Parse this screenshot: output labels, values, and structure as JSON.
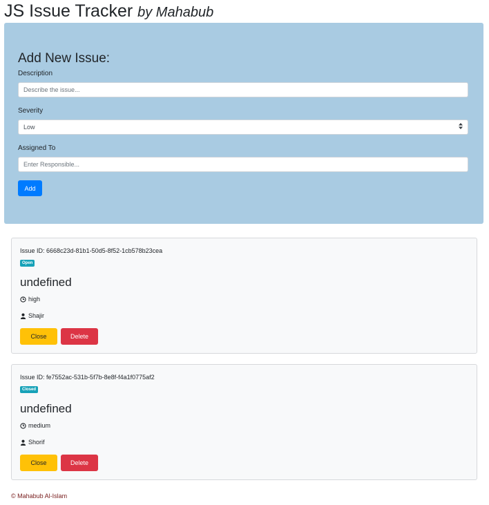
{
  "header": {
    "title": "JS Issue Tracker",
    "byline": "by Mahabub"
  },
  "form": {
    "heading": "Add New Issue:",
    "description_label": "Description",
    "description_placeholder": "Describe the issue...",
    "severity_label": "Severity",
    "severity_value": "Low",
    "assigned_label": "Assigned To",
    "assigned_placeholder": "Enter Responsible...",
    "add_label": "Add"
  },
  "issues": [
    {
      "id_text": "Issue ID: 6668c23d-81b1-50d5-8f52-1cb578b23cea",
      "status": "Open",
      "title": "undefined",
      "severity": "high",
      "assignee": "Shajir",
      "close_label": "Close",
      "delete_label": "Delete"
    },
    {
      "id_text": "Issue ID: fe7552ac-531b-5f7b-8e8f-f4a1f0775af2",
      "status": "Closed",
      "title": "undefined",
      "severity": "medium",
      "assignee": "Shorif",
      "close_label": "Close",
      "delete_label": "Delete"
    }
  ],
  "footer": {
    "text": "© Mahabub Al-Islam"
  },
  "colors": {
    "panel": "#a9cbe2",
    "primary": "#007bff",
    "badge": "#17a2b8",
    "warning": "#ffc107",
    "danger": "#dc3545"
  },
  "icons": {
    "severity": "clock-icon",
    "assignee": "user-icon",
    "select": "chevron-updown-icon"
  }
}
